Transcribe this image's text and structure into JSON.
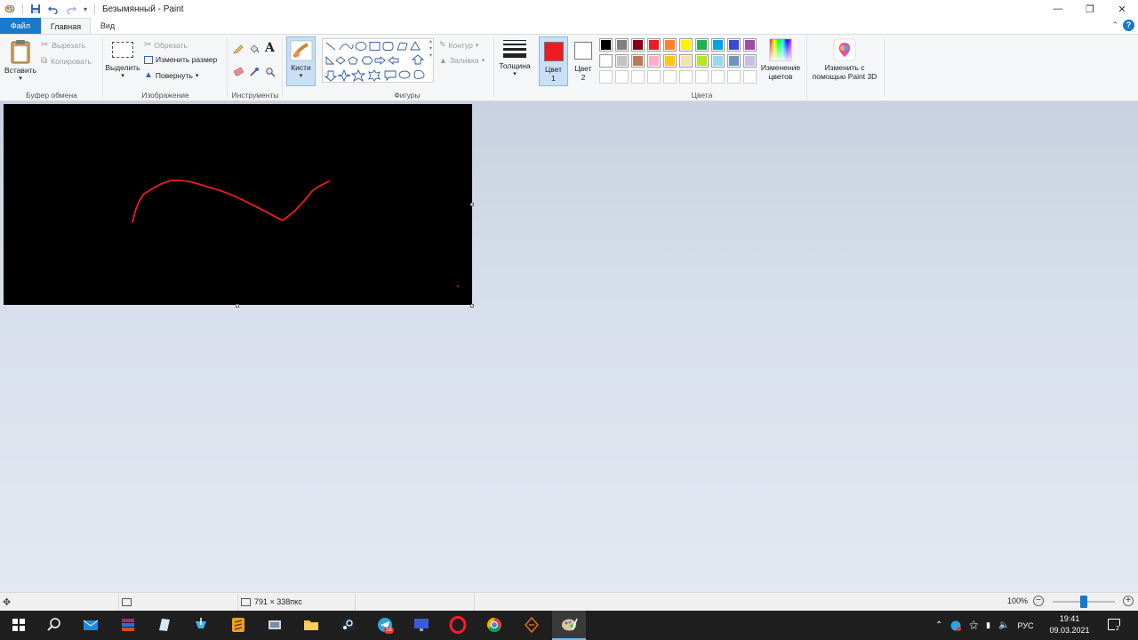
{
  "window": {
    "title": "Безымянный - Paint",
    "tabs": {
      "file": "Файл",
      "home": "Главная",
      "view": "Вид"
    },
    "help": "?"
  },
  "ribbon": {
    "clipboard": {
      "paste": "Вставить",
      "cut": "Вырезать",
      "copy": "Копировать",
      "label": "Буфер обмена"
    },
    "image": {
      "select": "Выделить",
      "crop": "Обрезать",
      "resize": "Изменить размер",
      "rotate": "Повернуть",
      "label": "Изображение"
    },
    "tools": {
      "label": "Инструменты"
    },
    "brushes": {
      "label": "Кисти"
    },
    "shapes": {
      "outline": "Контур",
      "fill": "Заливка",
      "label": "Фигуры"
    },
    "size": {
      "label": "Толщина"
    },
    "color1": {
      "label1": "Цвет",
      "label2": "1",
      "color": "#ed1c24"
    },
    "color2": {
      "label1": "Цвет",
      "label2": "2",
      "color": "#ffffff"
    },
    "colors": {
      "label": "Цвета",
      "palette_row1": [
        "#000000",
        "#7f7f7f",
        "#880015",
        "#ed1c24",
        "#ff7f27",
        "#fff200",
        "#22b14c",
        "#00a2e8",
        "#3f48cc",
        "#a349a4"
      ],
      "palette_row2": [
        "#ffffff",
        "#c3c3c3",
        "#b97a57",
        "#ffaec9",
        "#ffc90e",
        "#efe4b0",
        "#b5e61d",
        "#99d9ea",
        "#7092be",
        "#c8bfe7"
      ],
      "palette_row3_count": 10,
      "edit_colors_line1": "Изменение",
      "edit_colors_line2": "цветов"
    },
    "paint3d": {
      "line1": "Изменить с",
      "line2": "помощью Paint 3D"
    }
  },
  "canvas": {
    "background": "#000000",
    "stroke_color": "#ed1c24"
  },
  "status": {
    "dimensions": "791 × 338пкс",
    "zoom": "100%"
  },
  "taskbar": {
    "lang": "РУС",
    "time": "19:41",
    "date": "09.03.2021",
    "telegram_badge": "16",
    "notif_count": "2"
  }
}
